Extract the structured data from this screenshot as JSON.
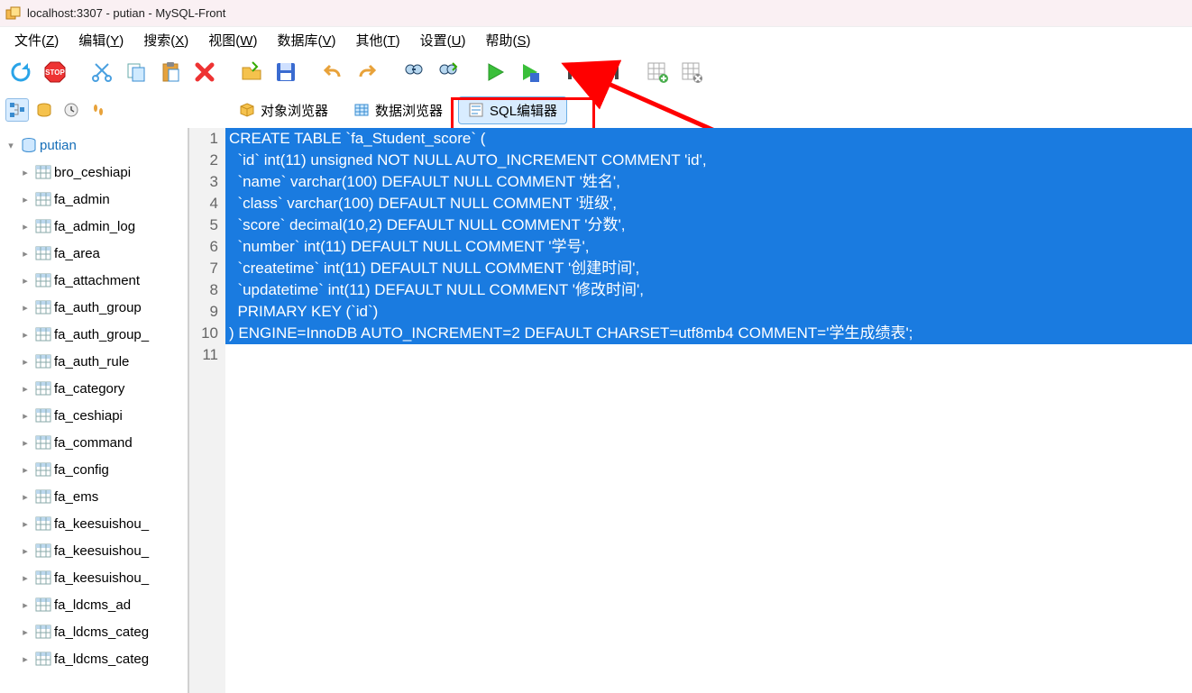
{
  "title": "localhost:3307 - putian - MySQL-Front",
  "menu": {
    "file": {
      "label": "文件",
      "key": "Z"
    },
    "edit": {
      "label": "编辑",
      "key": "Y"
    },
    "search": {
      "label": "搜索",
      "key": "X"
    },
    "view": {
      "label": "视图",
      "key": "W"
    },
    "database": {
      "label": "数据库",
      "key": "V"
    },
    "other": {
      "label": "其他",
      "key": "T"
    },
    "settings": {
      "label": "设置",
      "key": "U"
    },
    "help": {
      "label": "帮助",
      "key": "S"
    }
  },
  "tabs": {
    "object_browser": "对象浏览器",
    "data_browser": "数据浏览器",
    "sql_editor": "SQL编辑器"
  },
  "tree": {
    "db": "putian",
    "tables": [
      "bro_ceshiapi",
      "fa_admin",
      "fa_admin_log",
      "fa_area",
      "fa_attachment",
      "fa_auth_group",
      "fa_auth_group_",
      "fa_auth_rule",
      "fa_category",
      "fa_ceshiapi",
      "fa_command",
      "fa_config",
      "fa_ems",
      "fa_keesuishou_",
      "fa_keesuishou_",
      "fa_keesuishou_",
      "fa_ldcms_ad",
      "fa_ldcms_categ",
      "fa_ldcms_categ"
    ]
  },
  "sql": {
    "lines": [
      "CREATE TABLE `fa_Student_score` (",
      "  `id` int(11) unsigned NOT NULL AUTO_INCREMENT COMMENT 'id',",
      "  `name` varchar(100) DEFAULT NULL COMMENT '姓名',",
      "  `class` varchar(100) DEFAULT NULL COMMENT '班级',",
      "  `score` decimal(10,2) DEFAULT NULL COMMENT '分数',",
      "  `number` int(11) DEFAULT NULL COMMENT '学号',",
      "  `createtime` int(11) DEFAULT NULL COMMENT '创建时间',",
      "  `updatetime` int(11) DEFAULT NULL COMMENT '修改时间',",
      "  PRIMARY KEY (`id`)",
      ") ENGINE=InnoDB AUTO_INCREMENT=2 DEFAULT CHARSET=utf8mb4 COMMENT='学生成绩表';",
      ""
    ]
  },
  "colors": {
    "highlight_bg": "#1a7be0",
    "red": "#ff0000",
    "link": "#156eb8"
  }
}
